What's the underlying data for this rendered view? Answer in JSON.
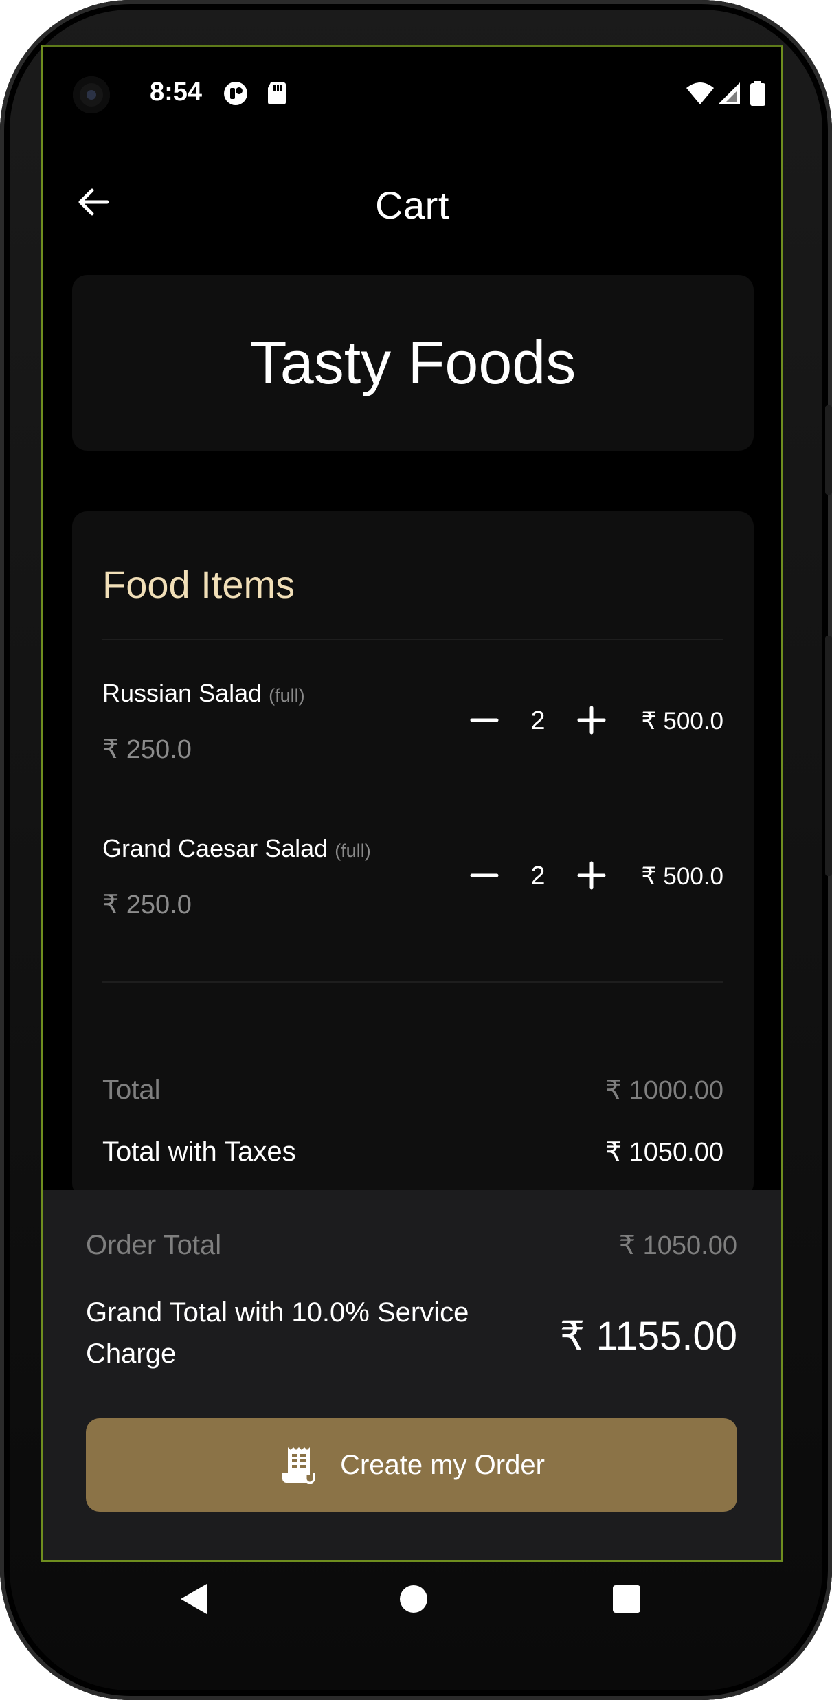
{
  "status_bar": {
    "time": "8:54",
    "icons": [
      "camera-hole",
      "app-notification-icon",
      "sd-card-icon",
      "wifi-icon",
      "signal-icon",
      "battery-icon"
    ]
  },
  "app_bar": {
    "back_icon": "arrow-left-icon",
    "title": "Cart"
  },
  "restaurant": {
    "name": "Tasty Foods"
  },
  "food_items": {
    "title": "Food Items",
    "items": [
      {
        "name": "Russian Salad",
        "variant": "(full)",
        "unit_price": "₹ 250.0",
        "quantity": "2",
        "line_total": "₹ 500.0"
      },
      {
        "name": "Grand Caesar Salad",
        "variant": "(full)",
        "unit_price": "₹ 250.0",
        "quantity": "2",
        "line_total": "₹ 500.0"
      }
    ],
    "total_label": "Total",
    "total_value": "₹ 1000.00",
    "total_taxes_label": "Total with Taxes",
    "total_taxes_value": "₹ 1050.00"
  },
  "footer": {
    "order_total_label": "Order Total",
    "order_total_value": "₹ 1050.00",
    "grand_total_label": "Grand Total with 10.0% Service Charge",
    "grand_total_value": "₹ 1155.00",
    "cta_label": "Create my Order",
    "cta_icon": "receipt-icon"
  },
  "colors": {
    "background": "#000000",
    "card": "#0f0f0f",
    "footer": "#1c1c1e",
    "accent_title": "#f1dfb8",
    "cta": "#8b7347",
    "muted_text": "#7f7f7f"
  }
}
